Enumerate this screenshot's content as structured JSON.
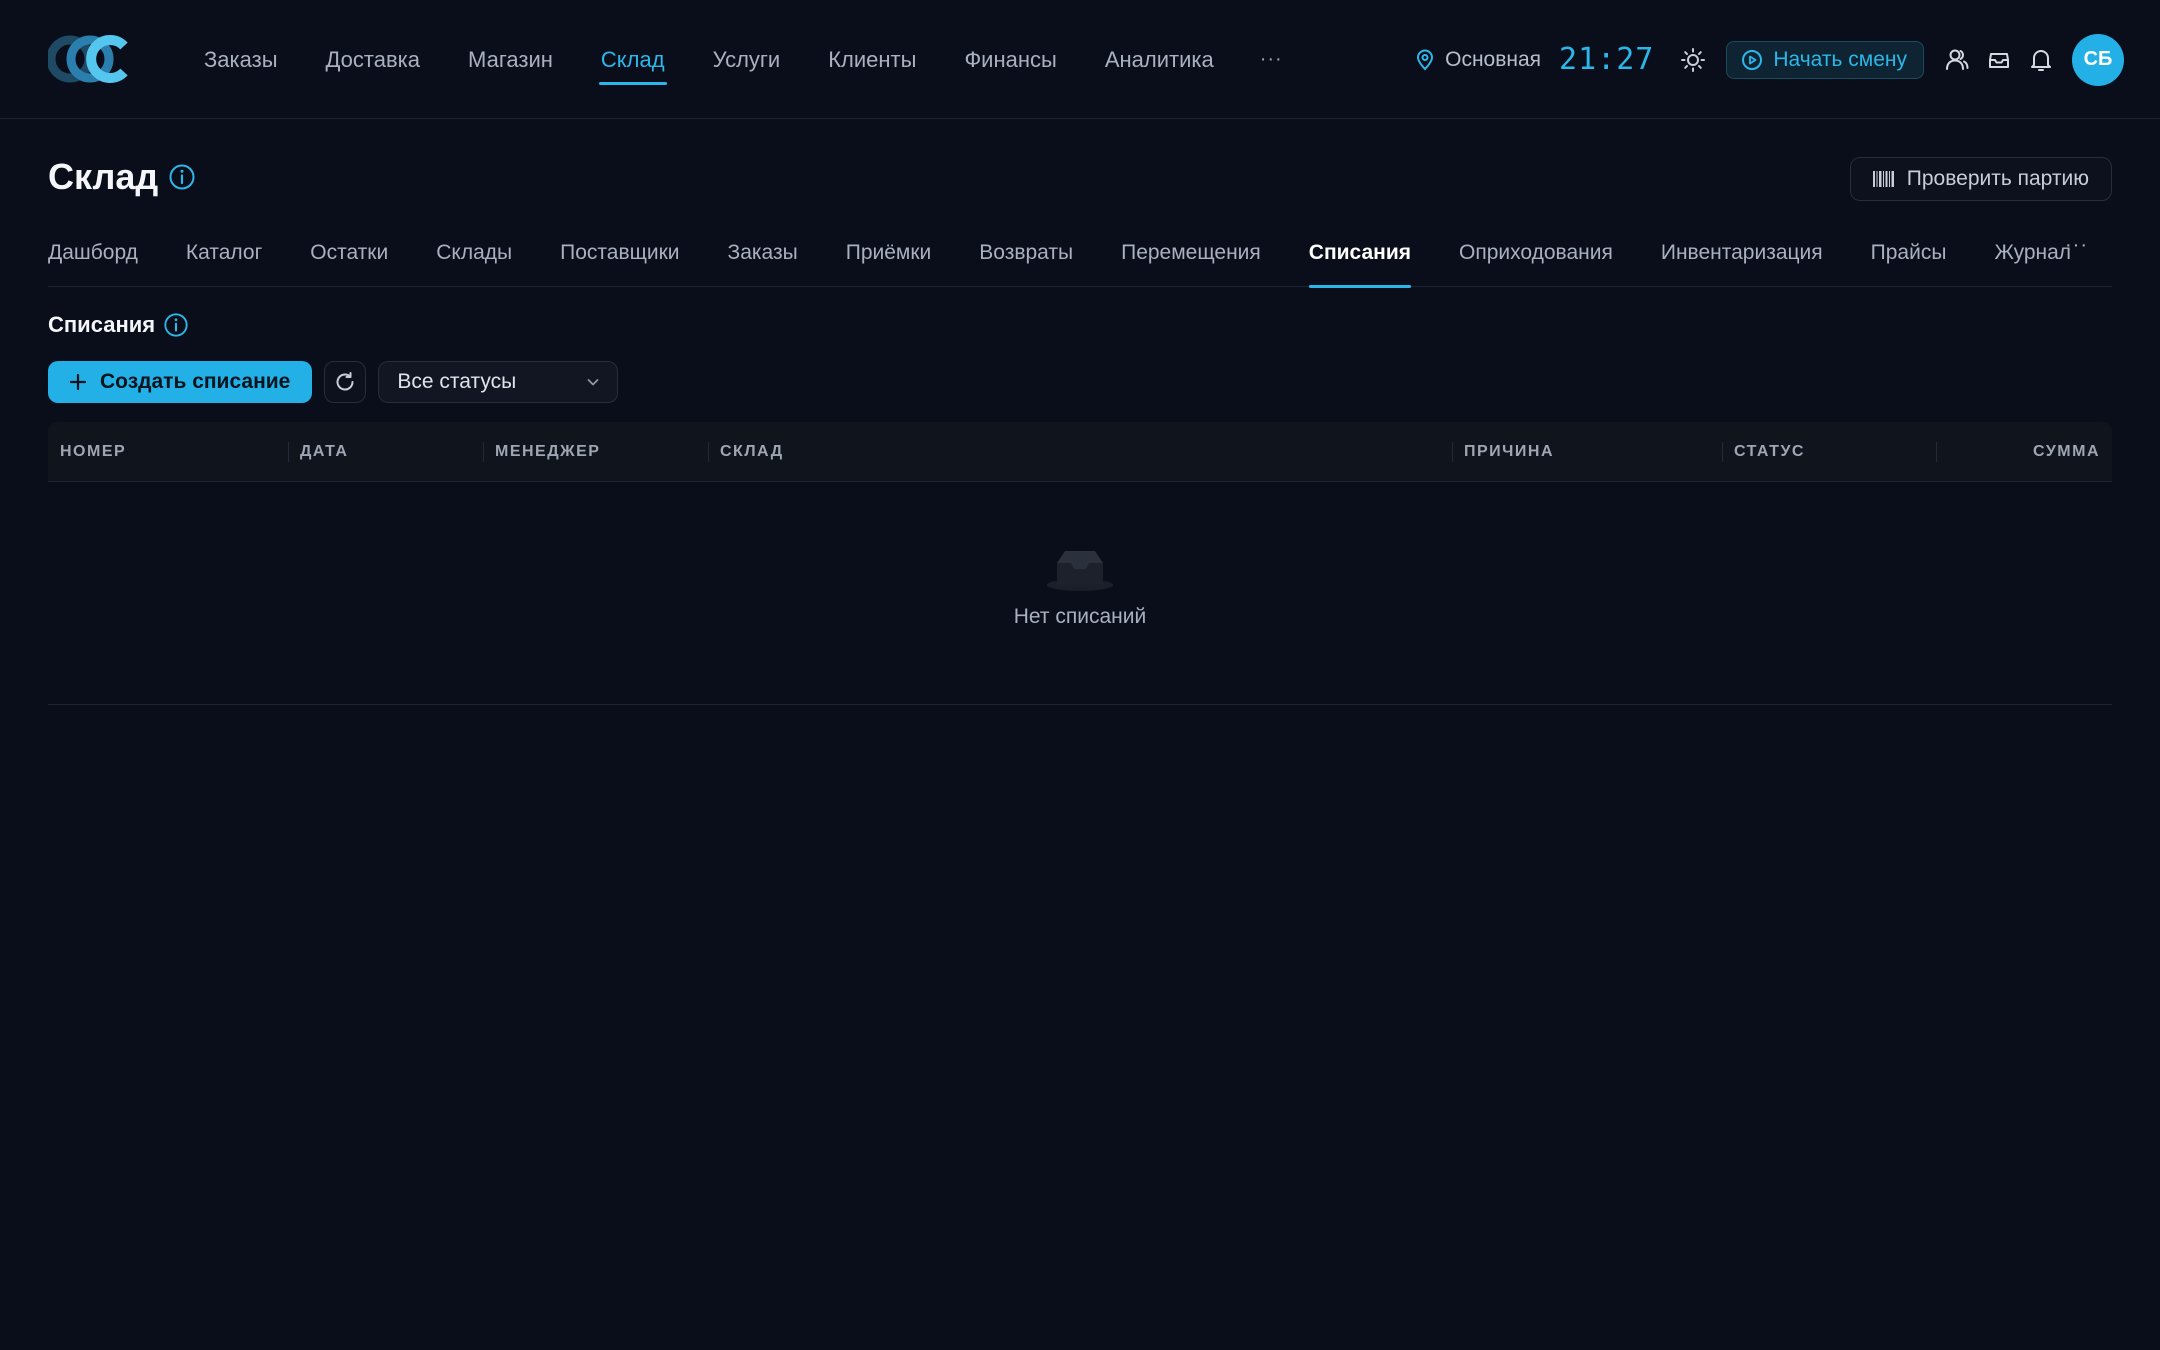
{
  "header": {
    "nav": [
      {
        "label": "Заказы"
      },
      {
        "label": "Доставка"
      },
      {
        "label": "Магазин"
      },
      {
        "label": "Склад",
        "active": true
      },
      {
        "label": "Услуги"
      },
      {
        "label": "Клиенты"
      },
      {
        "label": "Финансы"
      },
      {
        "label": "Аналитика"
      }
    ],
    "more_label": "···",
    "location": "Основная",
    "clock": "21:27",
    "start_shift_label": "Начать смену",
    "avatar_initials": "СБ",
    "icons": [
      "logo",
      "location-pin-icon",
      "sun-icon",
      "play-circle-icon",
      "users-icon",
      "inbox-icon",
      "bell-icon"
    ]
  },
  "page": {
    "title": "Склад",
    "check_batch_label": "Проверить партию"
  },
  "subtabs": {
    "items": [
      {
        "label": "Дашборд"
      },
      {
        "label": "Каталог"
      },
      {
        "label": "Остатки"
      },
      {
        "label": "Склады"
      },
      {
        "label": "Поставщики"
      },
      {
        "label": "Заказы"
      },
      {
        "label": "Приёмки"
      },
      {
        "label": "Возвраты"
      },
      {
        "label": "Перемещения"
      },
      {
        "label": "Списания",
        "active": true
      },
      {
        "label": "Оприходования"
      },
      {
        "label": "Инвентаризация"
      },
      {
        "label": "Прайсы"
      },
      {
        "label": "Журнал"
      }
    ],
    "more_label": "···"
  },
  "section": {
    "title": "Списания",
    "create_label": "Создать списание",
    "status_filter": "Все статусы"
  },
  "table": {
    "columns": [
      "НОМЕР",
      "ДАТА",
      "МЕНЕДЖЕР",
      "СКЛАД",
      "ПРИЧИНА",
      "СТАТУС",
      "СУММА"
    ],
    "rows": [],
    "empty_text": "Нет списаний"
  },
  "colors": {
    "accent": "#2bb7ea",
    "background": "#0a0e1a",
    "avatar": "#22b0e6"
  }
}
